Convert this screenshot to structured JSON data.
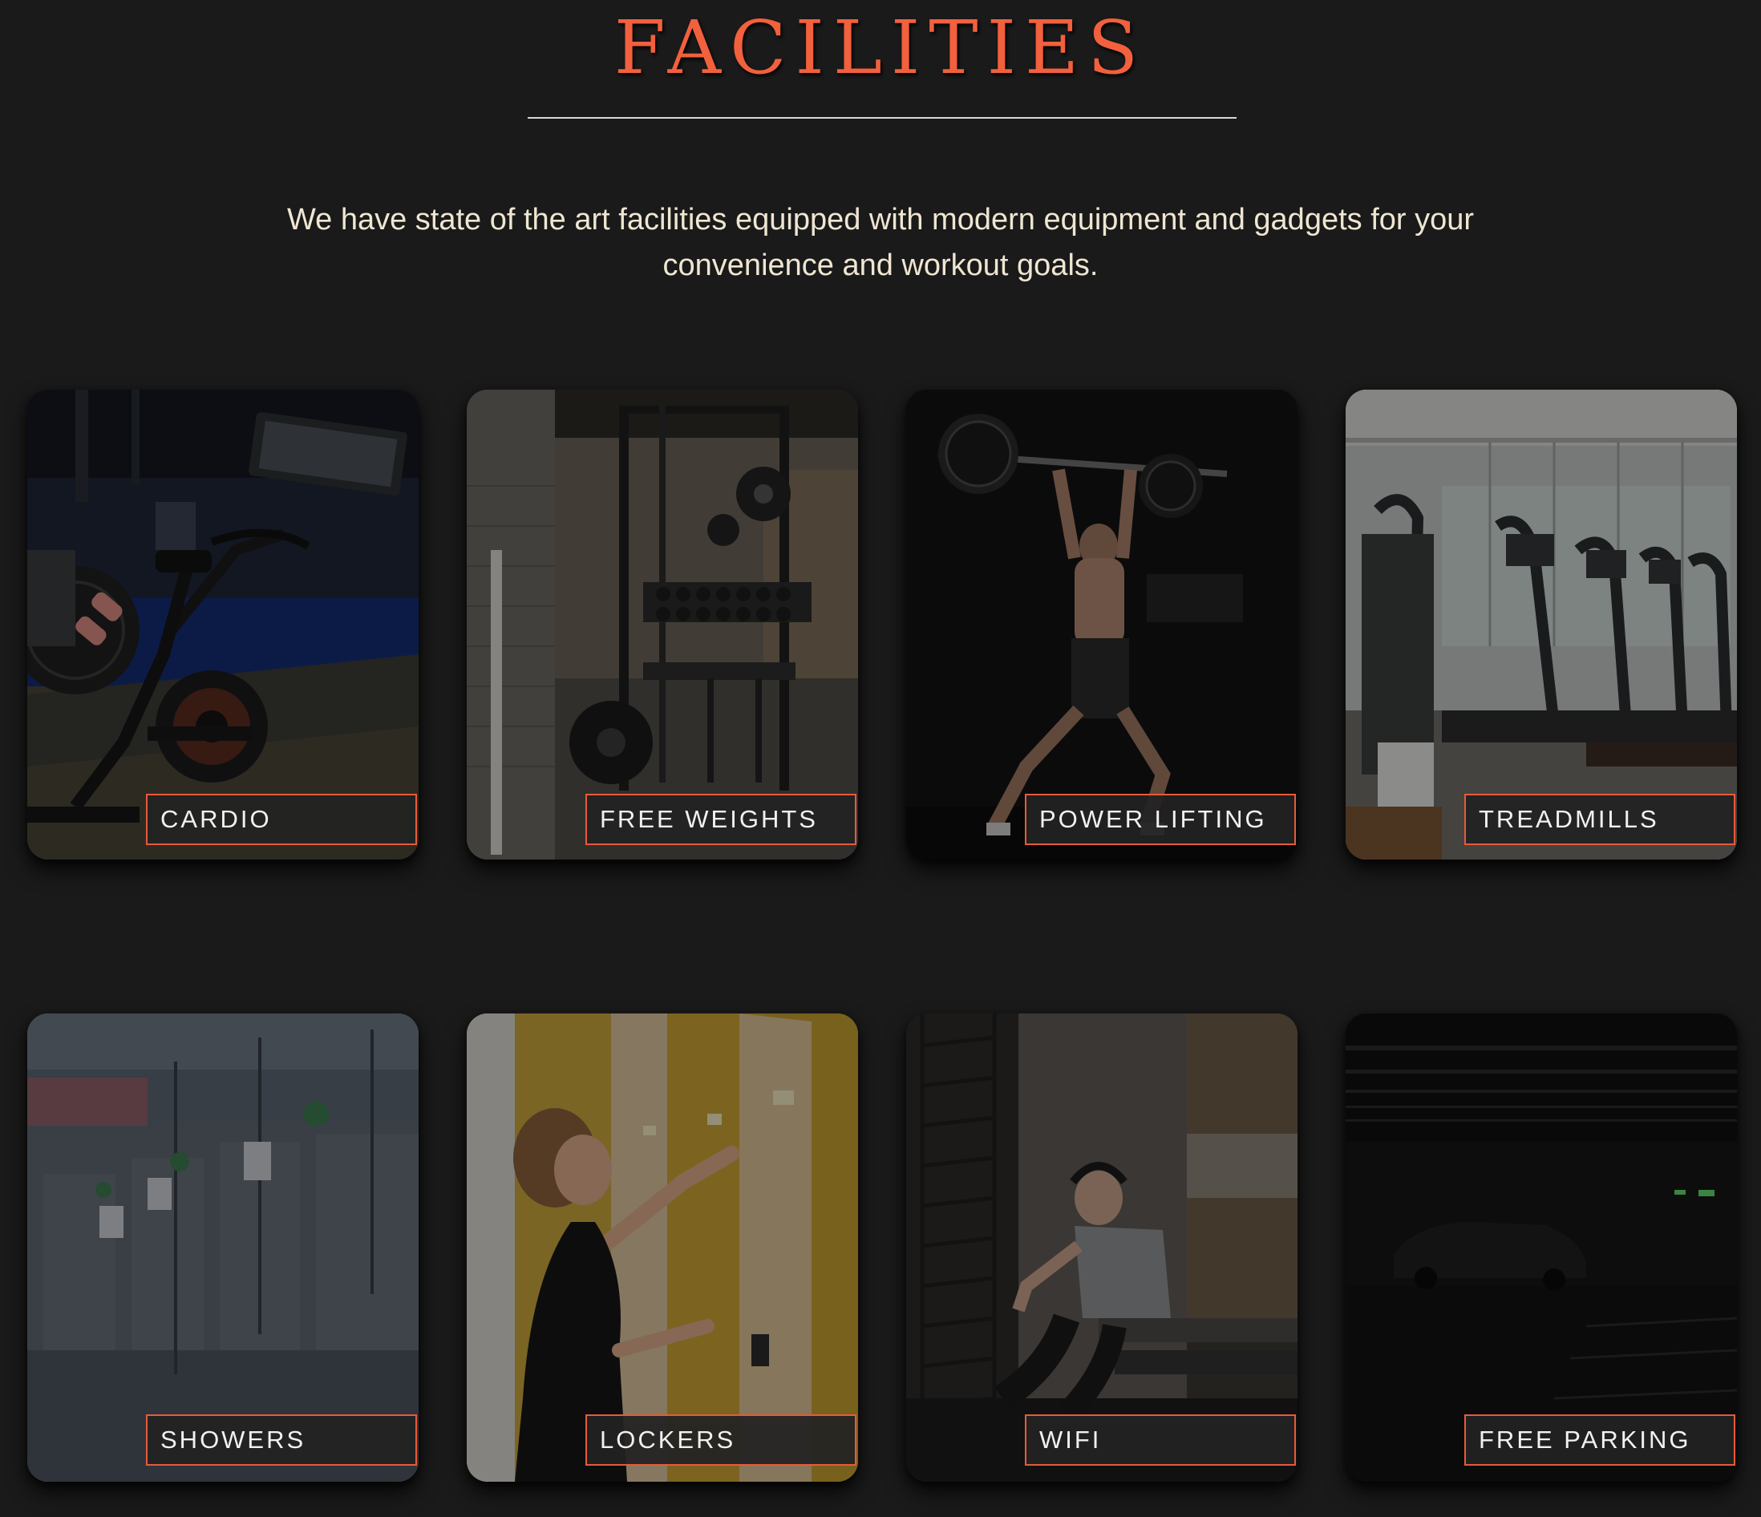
{
  "section": {
    "title": "FACILITIES",
    "description": "We have state of the art facilities equipped with modern equipment and gadgets for your convenience and workout goals.",
    "accent_color": "#f2603d",
    "background_color": "#1a1a1a"
  },
  "facilities": [
    {
      "label": "CARDIO",
      "image": "exercise-bike-photo"
    },
    {
      "label": "FREE WEIGHTS",
      "image": "squat-rack-photo"
    },
    {
      "label": "POWER LIFTING",
      "image": "overhead-barbell-lift-photo"
    },
    {
      "label": "TREADMILLS",
      "image": "treadmill-row-photo"
    },
    {
      "label": "SHOWERS",
      "image": "shower-room-photo"
    },
    {
      "label": "LOCKERS",
      "image": "locker-room-photo"
    },
    {
      "label": "WIFI",
      "image": "man-on-phone-photo"
    },
    {
      "label": "FREE PARKING",
      "image": "parking-garage-photo"
    }
  ]
}
